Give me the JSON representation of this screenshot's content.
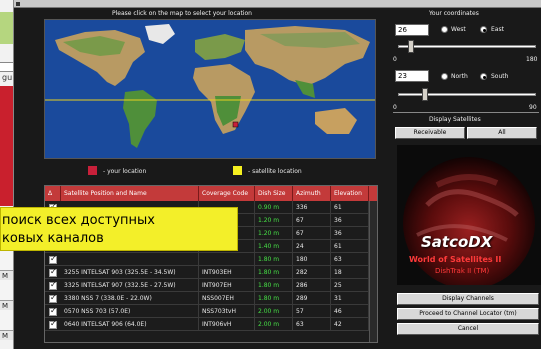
{
  "map_panel": {
    "instruction": "Please click on the map to select your location",
    "legend_your_location": "- your location",
    "legend_satellite_location": "- satellite location",
    "colors": {
      "your_location": "#c8203a",
      "satellite_location": "#f5f020",
      "ocean": "#1a4a9c"
    }
  },
  "coordinates": {
    "title": "Your coordinates",
    "longitude_value": "26",
    "west_label": "West",
    "east_label": "East",
    "longitude_selected": "East",
    "lon_min": "0",
    "lon_max": "180",
    "latitude_value": "23",
    "north_label": "North",
    "south_label": "South",
    "latitude_selected": "South",
    "lat_min": "0",
    "lat_max": "90"
  },
  "display_satellites": {
    "title": "Display Satellites",
    "receivable_button": "Receivable",
    "all_button": "All"
  },
  "branding": {
    "logo": "SatcoDX",
    "subtitle": "World of Satellites II",
    "product": "DishTrak II (TM)"
  },
  "actions": {
    "display_channels": "Display Channels",
    "proceed": "Proceed to Channel Locator (tm)",
    "cancel": "Cancel"
  },
  "table": {
    "headers": {
      "sort": "Δ",
      "name": "Satellite Position and Name",
      "code": "Coverage Code",
      "dish": "Dish Size",
      "azimuth": "Azimuth",
      "elevation": "Elevation"
    },
    "rows": [
      {
        "name": "",
        "code": "",
        "dish": "0.90 m",
        "azimuth": "336",
        "elevation": "61"
      },
      {
        "name": "",
        "code": "",
        "dish": "1.20 m",
        "azimuth": "67",
        "elevation": "36"
      },
      {
        "name": "",
        "code": "",
        "dish": "1.20 m",
        "azimuth": "67",
        "elevation": "36"
      },
      {
        "name": "",
        "code": "",
        "dish": "1.40 m",
        "azimuth": "24",
        "elevation": "61"
      },
      {
        "name": "",
        "code": "",
        "dish": "1.80 m",
        "azimuth": "180",
        "elevation": "63"
      },
      {
        "name": "3255 INTELSAT 903 (325.5E - 34.5W)",
        "code": "INT903EH",
        "dish": "1.80 m",
        "azimuth": "282",
        "elevation": "18"
      },
      {
        "name": "3325 INTELSAT 907 (332.5E - 27.5W)",
        "code": "INT907EH",
        "dish": "1.80 m",
        "azimuth": "286",
        "elevation": "25"
      },
      {
        "name": "3380 NSS 7 (338.0E - 22.0W)",
        "code": "NSS007EH",
        "dish": "1.80 m",
        "azimuth": "289",
        "elevation": "31"
      },
      {
        "name": "0570 NSS 703 (57.0E)",
        "code": "NSS703tvH",
        "dish": "2.00 m",
        "azimuth": "57",
        "elevation": "46"
      },
      {
        "name": "0640 INTELSAT 906 (64.0E)",
        "code": "INT906vH",
        "dish": "2.00 m",
        "azimuth": "63",
        "elevation": "42"
      }
    ]
  },
  "overlay": {
    "line1": "поиск всех доступных",
    "line2": "ковых каналов"
  },
  "background_app": {
    "text1": "gu",
    "mark1": "M",
    "mark2": "M",
    "mark3": "M"
  }
}
